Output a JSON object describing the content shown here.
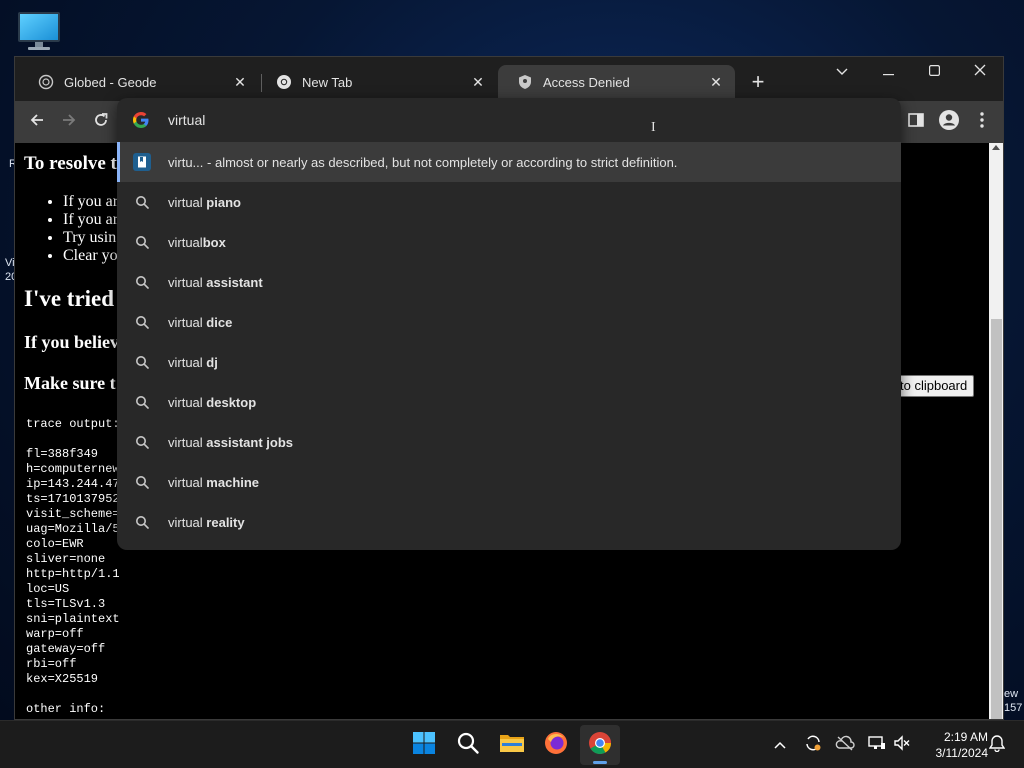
{
  "desktop": {
    "left_fragments": [
      "R",
      "Vi",
      "20"
    ],
    "right_fragments": [
      "ew",
      "157"
    ]
  },
  "browser": {
    "tabs": [
      {
        "title": "Globed - Geode",
        "icon": "globe-icon",
        "active": false
      },
      {
        "title": "New Tab",
        "icon": "chrome-icon",
        "active": false
      },
      {
        "title": "Access Denied",
        "icon": "shield-icon",
        "active": true
      }
    ],
    "close_glyph": "✕",
    "newtab_glyph": "+"
  },
  "omnibox": {
    "query": "virtual",
    "suggestions": [
      {
        "prefix": "virtu...",
        "bold": "",
        "desc": " - almost or nearly as described, but not completely or according to strict definition.",
        "icon": "dictionary-icon",
        "selected": true
      },
      {
        "prefix": "virtual ",
        "bold": "piano",
        "icon": "search-icon"
      },
      {
        "prefix": "virtual",
        "bold": "box",
        "icon": "search-icon"
      },
      {
        "prefix": "virtual ",
        "bold": "assistant",
        "icon": "search-icon"
      },
      {
        "prefix": "virtual ",
        "bold": "dice",
        "icon": "search-icon"
      },
      {
        "prefix": "virtual ",
        "bold": "dj",
        "icon": "search-icon"
      },
      {
        "prefix": "virtual ",
        "bold": "desktop",
        "icon": "search-icon"
      },
      {
        "prefix": "virtual ",
        "bold": "assistant jobs",
        "icon": "search-icon"
      },
      {
        "prefix": "virtual ",
        "bold": "machine",
        "icon": "search-icon"
      },
      {
        "prefix": "virtual ",
        "bold": "reality",
        "icon": "search-icon"
      }
    ]
  },
  "page": {
    "heading_resolve": "To resolve th",
    "bullets": [
      "If you ar",
      "If you ar",
      "Try usin",
      "Clear yo"
    ],
    "heading_tried": "I've tried",
    "heading_believe": "If you believ",
    "heading_make": "Make sure t",
    "copy_button": "to clipboard",
    "trace_lines": [
      "trace output:",
      "",
      "fl=388f349",
      "h=computernew",
      "ip=143.244.47",
      "ts=1710137952",
      "visit_scheme=",
      "uag=Mozilla/5",
      "colo=EWR",
      "sliver=none",
      "http=http/1.1",
      "loc=US",
      "tls=TLSv1.3",
      "sni=plaintext",
      "warp=off",
      "gateway=off",
      "rbi=off",
      "kex=X25519",
      "",
      "other info:"
    ]
  },
  "taskbar": {
    "time": "2:19 AM",
    "date": "3/11/2024"
  },
  "colors": {
    "accent": "#8ab4f8",
    "toolbar": "#3c3c3c",
    "tabstrip": "#1f1f1f",
    "dropdown": "#282828"
  }
}
